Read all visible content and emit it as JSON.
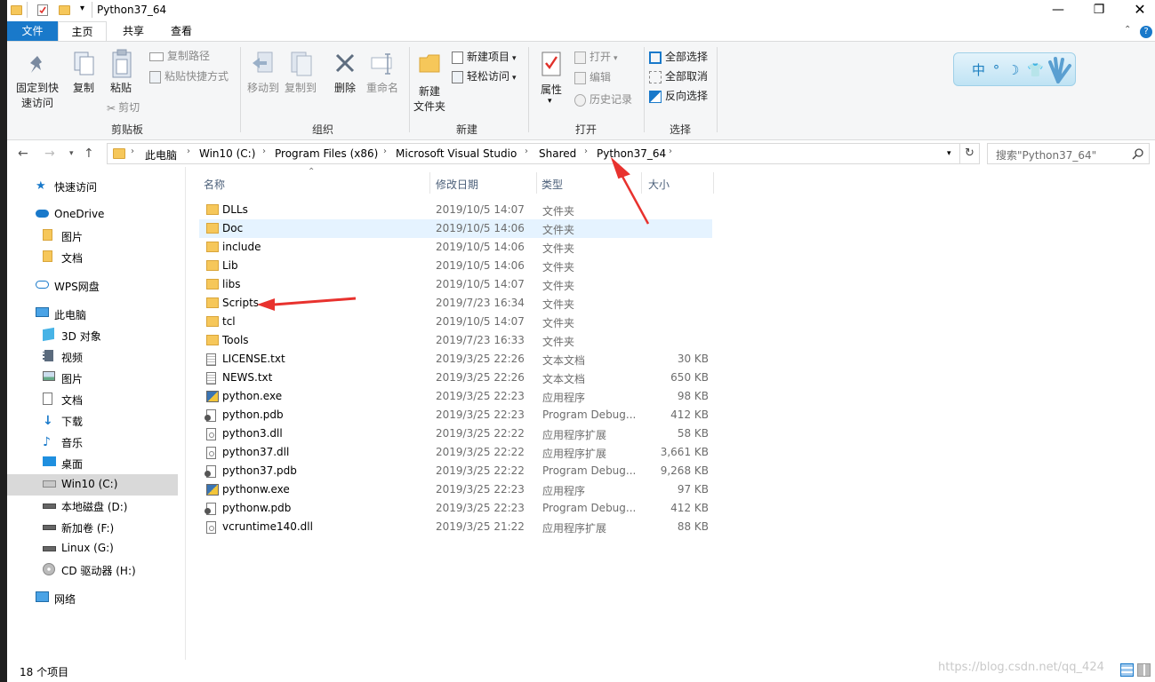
{
  "window": {
    "title": "Python37_64"
  },
  "tabs": [
    {
      "label": "文件"
    },
    {
      "label": "主页"
    },
    {
      "label": "共享"
    },
    {
      "label": "查看"
    }
  ],
  "ribbon": {
    "clipboard": {
      "group_label": "剪贴板",
      "pin": "固定到快速访问",
      "pin_line1": "固定到快",
      "pin_line2": "速访问",
      "copy": "复制",
      "paste": "粘贴",
      "copy_path": "复制路径",
      "paste_shortcut": "粘贴快捷方式",
      "cut": "剪切"
    },
    "organize": {
      "group_label": "组织",
      "move_to": "移动到",
      "copy_to": "复制到",
      "delete": "删除",
      "rename": "重命名"
    },
    "new": {
      "group_label": "新建",
      "new_folder_line1": "新建",
      "new_folder_line2": "文件夹",
      "new_item": "新建项目",
      "easy_access": "轻松访问"
    },
    "open": {
      "group_label": "打开",
      "properties": "属性",
      "open": "打开",
      "edit": "编辑",
      "history": "历史记录"
    },
    "select": {
      "group_label": "选择",
      "select_all": "全部选择",
      "select_none": "全部取消",
      "invert": "反向选择"
    },
    "badge": "中 ° ☽ 👕"
  },
  "address": {
    "crumbs": [
      "此电脑",
      "Win10 (C:)",
      "Program Files (x86)",
      "Microsoft Visual Studio",
      "Shared",
      "Python37_64"
    ],
    "search_placeholder": "搜索\"Python37_64\""
  },
  "nav": [
    {
      "label": "快速访问",
      "icon": "star-icon"
    },
    {
      "label": "OneDrive",
      "icon": "cloud-icon"
    },
    {
      "label": "图片",
      "icon": "folder-icon"
    },
    {
      "label": "文档",
      "icon": "folder-icon"
    },
    {
      "label": "WPS网盘",
      "icon": "cloud-outline-icon"
    },
    {
      "label": "此电脑",
      "icon": "computer-icon"
    },
    {
      "label": "3D 对象",
      "icon": "cube-icon"
    },
    {
      "label": "视频",
      "icon": "film-icon"
    },
    {
      "label": "图片",
      "icon": "picture-icon"
    },
    {
      "label": "文档",
      "icon": "document-icon"
    },
    {
      "label": "下载",
      "icon": "download-icon"
    },
    {
      "label": "音乐",
      "icon": "music-icon"
    },
    {
      "label": "桌面",
      "icon": "desktop-icon"
    },
    {
      "label": "Win10 (C:)",
      "icon": "drive-windows-icon"
    },
    {
      "label": "本地磁盘 (D:)",
      "icon": "drive-icon"
    },
    {
      "label": "新加卷 (F:)",
      "icon": "drive-icon"
    },
    {
      "label": "Linux (G:)",
      "icon": "drive-icon"
    },
    {
      "label": "CD 驱动器 (H:)",
      "icon": "cd-drive-icon"
    },
    {
      "label": "网络",
      "icon": "network-icon"
    }
  ],
  "columns": {
    "name": "名称",
    "date": "修改日期",
    "type": "类型",
    "size": "大小"
  },
  "files": [
    {
      "name": "DLLs",
      "date": "2019/10/5 14:07",
      "type": "文件夹",
      "size": "",
      "icon": "folder-icon"
    },
    {
      "name": "Doc",
      "date": "2019/10/5 14:06",
      "type": "文件夹",
      "size": "",
      "icon": "folder-icon"
    },
    {
      "name": "include",
      "date": "2019/10/5 14:06",
      "type": "文件夹",
      "size": "",
      "icon": "folder-icon"
    },
    {
      "name": "Lib",
      "date": "2019/10/5 14:06",
      "type": "文件夹",
      "size": "",
      "icon": "folder-icon"
    },
    {
      "name": "libs",
      "date": "2019/10/5 14:07",
      "type": "文件夹",
      "size": "",
      "icon": "folder-icon"
    },
    {
      "name": "Scripts",
      "date": "2019/7/23 16:34",
      "type": "文件夹",
      "size": "",
      "icon": "folder-icon"
    },
    {
      "name": "tcl",
      "date": "2019/10/5 14:07",
      "type": "文件夹",
      "size": "",
      "icon": "folder-icon"
    },
    {
      "name": "Tools",
      "date": "2019/7/23 16:33",
      "type": "文件夹",
      "size": "",
      "icon": "folder-icon"
    },
    {
      "name": "LICENSE.txt",
      "date": "2019/3/25 22:26",
      "type": "文本文档",
      "size": "30 KB",
      "icon": "text-file-icon"
    },
    {
      "name": "NEWS.txt",
      "date": "2019/3/25 22:26",
      "type": "文本文档",
      "size": "650 KB",
      "icon": "text-file-icon"
    },
    {
      "name": "python.exe",
      "date": "2019/3/25 22:23",
      "type": "应用程序",
      "size": "98 KB",
      "icon": "python-exe-icon"
    },
    {
      "name": "python.pdb",
      "date": "2019/3/25 22:23",
      "type": "Program Debug...",
      "size": "412 KB",
      "icon": "pdb-file-icon"
    },
    {
      "name": "python3.dll",
      "date": "2019/3/25 22:22",
      "type": "应用程序扩展",
      "size": "58 KB",
      "icon": "dll-file-icon"
    },
    {
      "name": "python37.dll",
      "date": "2019/3/25 22:22",
      "type": "应用程序扩展",
      "size": "3,661 KB",
      "icon": "dll-file-icon"
    },
    {
      "name": "python37.pdb",
      "date": "2019/3/25 22:22",
      "type": "Program Debug...",
      "size": "9,268 KB",
      "icon": "pdb-file-icon"
    },
    {
      "name": "pythonw.exe",
      "date": "2019/3/25 22:23",
      "type": "应用程序",
      "size": "97 KB",
      "icon": "python-exe-icon"
    },
    {
      "name": "pythonw.pdb",
      "date": "2019/3/25 22:23",
      "type": "Program Debug...",
      "size": "412 KB",
      "icon": "pdb-file-icon"
    },
    {
      "name": "vcruntime140.dll",
      "date": "2019/3/25 21:22",
      "type": "应用程序扩展",
      "size": "88 KB",
      "icon": "dll-file-icon"
    }
  ],
  "status": {
    "count": "18 个项目"
  },
  "watermark": "https://blog.csdn.net/qq_424",
  "colors": {
    "accent": "#1979ca",
    "folder": "#f6c75a",
    "selection": "#cce8ff",
    "annotation": "#e8322e"
  }
}
